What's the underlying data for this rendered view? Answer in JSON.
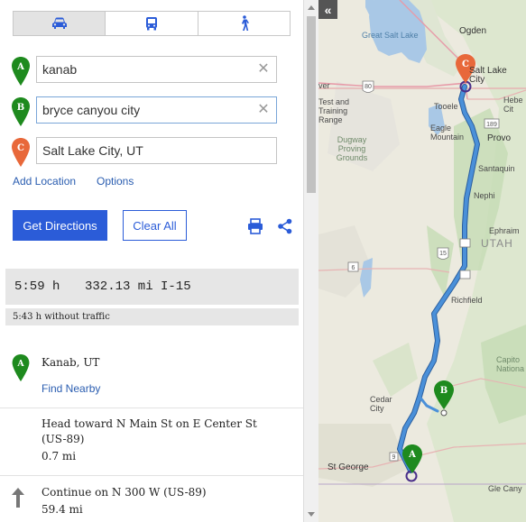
{
  "modes": [
    {
      "icon": "car-icon",
      "active": true
    },
    {
      "icon": "bus-icon",
      "active": false
    },
    {
      "icon": "walk-icon",
      "active": false
    }
  ],
  "locations": [
    {
      "marker": "A",
      "value": "kanab",
      "color": "#1e8a1e"
    },
    {
      "marker": "B",
      "value": "bryce canyou city",
      "color": "#1e8a1e"
    },
    {
      "marker": "C",
      "value": "Salt Lake City, UT",
      "color": "#e8683a"
    }
  ],
  "links": {
    "add_location": "Add Location",
    "options": "Options"
  },
  "buttons": {
    "get_directions": "Get Directions",
    "clear_all": "Clear All"
  },
  "summary": {
    "time": "5:59 h",
    "distance": "332.13 mi",
    "route": "I-15",
    "without_traffic": "5:43 h without traffic"
  },
  "steps": {
    "start": {
      "marker": "A",
      "place": "Kanab, UT",
      "find_nearby": "Find Nearby"
    },
    "list": [
      {
        "instruction": "Head toward N Main St on E Center St (US-89)",
        "distance": "0.7 mi",
        "icon": "none"
      },
      {
        "instruction": "Continue on N 300 W (US-89)",
        "distance": "59.4 mi",
        "icon": "arrow-up-icon"
      }
    ]
  },
  "map": {
    "labels": {
      "great_salt_lake": "Great Salt Lake",
      "ogden": "Ogden",
      "salt_lake_city": "Salt Lake City",
      "hebe": "Hebe Cit",
      "river": "ver",
      "test_training": "Test and Training Range",
      "tooele": "Tooele",
      "eagle_mountain": "Eagle Mountain",
      "provo": "Provo",
      "dugway": "Dugway Proving Grounds",
      "santaquin": "Santaquin",
      "nephi": "Nephi",
      "ephraim": "Ephraim",
      "utah": "UTAH",
      "richfield": "Richfield",
      "capitol_reef": "Capito Nationa",
      "cedar_city": "Cedar City",
      "st_george": "St George",
      "mile": "Gle Cany"
    },
    "shields": {
      "i80": "80",
      "i15": "15",
      "us6": "6",
      "us189": "189",
      "us9": "9",
      "i15b": "15"
    },
    "route_color": "#4a90d9",
    "markers": [
      {
        "letter": "A",
        "color": "#1e8a1e"
      },
      {
        "letter": "B",
        "color": "#1e8a1e"
      },
      {
        "letter": "C",
        "color": "#e8683a"
      }
    ]
  }
}
